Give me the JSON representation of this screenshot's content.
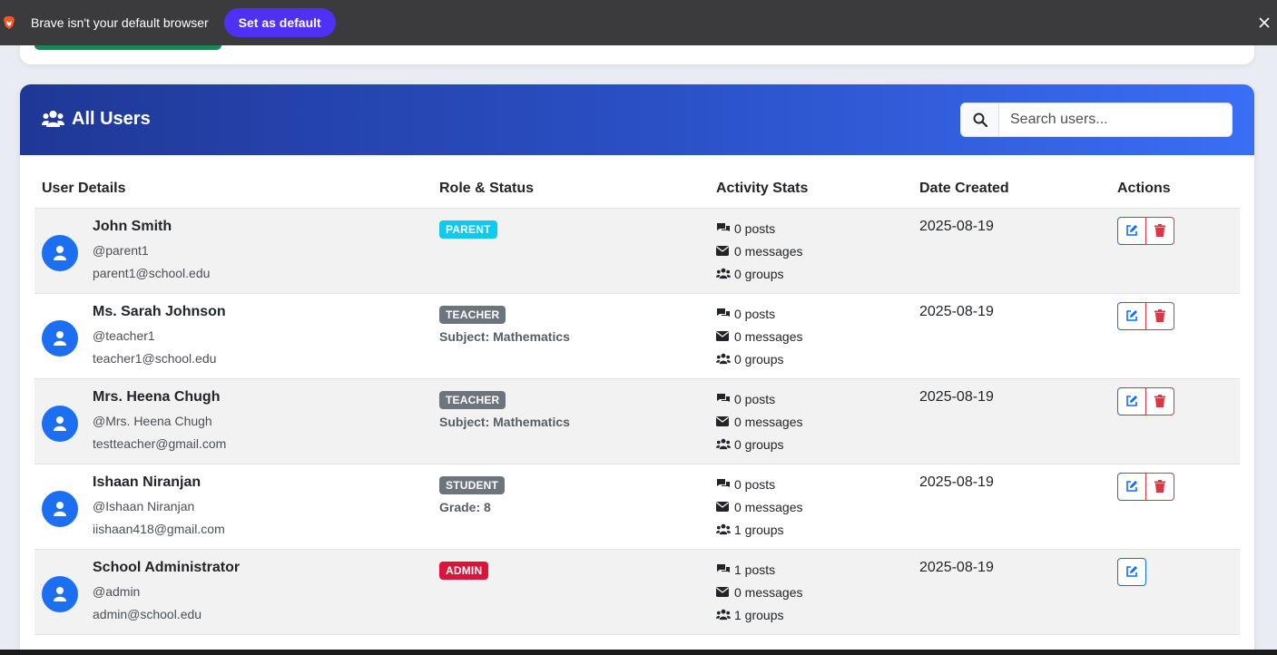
{
  "browser_bar": {
    "message": "Brave isn't your default browser",
    "set_default_label": "Set as default"
  },
  "card": {
    "title": "All Users",
    "search_placeholder": "Search users..."
  },
  "table": {
    "headers": [
      "User Details",
      "Role & Status",
      "Activity Stats",
      "Date Created",
      "Actions"
    ],
    "rows": [
      {
        "name": "John Smith",
        "handle": "@parent1",
        "email": "parent1@school.edu",
        "role": "PARENT",
        "role_extra": "",
        "posts": "0 posts",
        "messages": "0 messages",
        "groups": "0 groups",
        "date": "2025-08-19"
      },
      {
        "name": "Ms. Sarah Johnson",
        "handle": "@teacher1",
        "email": "teacher1@school.edu",
        "role": "TEACHER",
        "role_extra": "Subject: Mathematics",
        "posts": "0 posts",
        "messages": "0 messages",
        "groups": "0 groups",
        "date": "2025-08-19"
      },
      {
        "name": "Mrs. Heena Chugh",
        "handle": "@Mrs. Heena Chugh",
        "email": "testteacher@gmail.com",
        "role": "TEACHER",
        "role_extra": "Subject: Mathematics",
        "posts": "0 posts",
        "messages": "0 messages",
        "groups": "0 groups",
        "date": "2025-08-19"
      },
      {
        "name": "Ishaan Niranjan",
        "handle": "@Ishaan Niranjan",
        "email": "iishaan418@gmail.com",
        "role": "STUDENT",
        "role_extra": "Grade: 8",
        "posts": "0 posts",
        "messages": "0 messages",
        "groups": "1 groups",
        "date": "2025-08-19"
      },
      {
        "name": "School Administrator",
        "handle": "@admin",
        "email": "admin@school.edu",
        "role": "ADMIN",
        "role_extra": "",
        "posts": "1 posts",
        "messages": "0 messages",
        "groups": "1 groups",
        "date": "2025-08-19"
      }
    ]
  },
  "colors": {
    "header_gradient_start": "#1f3896",
    "header_gradient_end": "#3a6ef5",
    "avatar": "#1d6ff2",
    "parent_badge": "#0dcaf0",
    "teacher_badge": "#6c757d",
    "student_badge": "#6c757d",
    "admin_badge": "#dc143c",
    "edit_button": "#0d6efd",
    "delete_button": "#dc3545",
    "set_default_button": "#4f30f5"
  }
}
